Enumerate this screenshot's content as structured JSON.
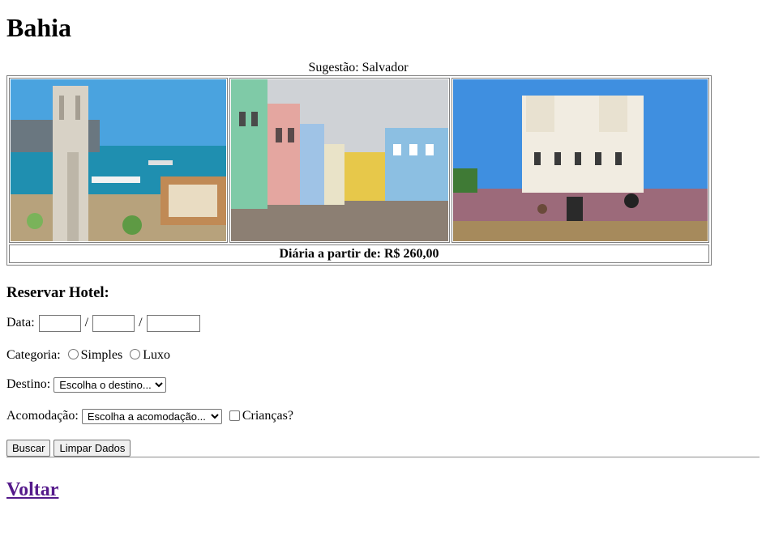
{
  "page": {
    "title": "Bahia"
  },
  "gallery": {
    "caption": "Sugestão: Salvador",
    "price_text": "Diária a partir de: R$ 260,00"
  },
  "form": {
    "heading": "Reservar Hotel:",
    "date_label": "Data:",
    "date_sep1": "/",
    "date_sep2": "/",
    "category_label": "Categoria:",
    "category_options": [
      "Simples",
      "Luxo"
    ],
    "destination_label": "Destino:",
    "destination_selected": "Escolha o destino...",
    "accommodation_label": "Acomodação:",
    "accommodation_selected": "Escolha a acomodação...",
    "children_label": "Crianças?",
    "search_button": "Buscar",
    "clear_button": "Limpar Dados"
  },
  "footer": {
    "back_link": "Voltar"
  },
  "colors": {
    "link_visited": "#551a8b",
    "border": "#808080",
    "button_bg": "#efefef"
  }
}
